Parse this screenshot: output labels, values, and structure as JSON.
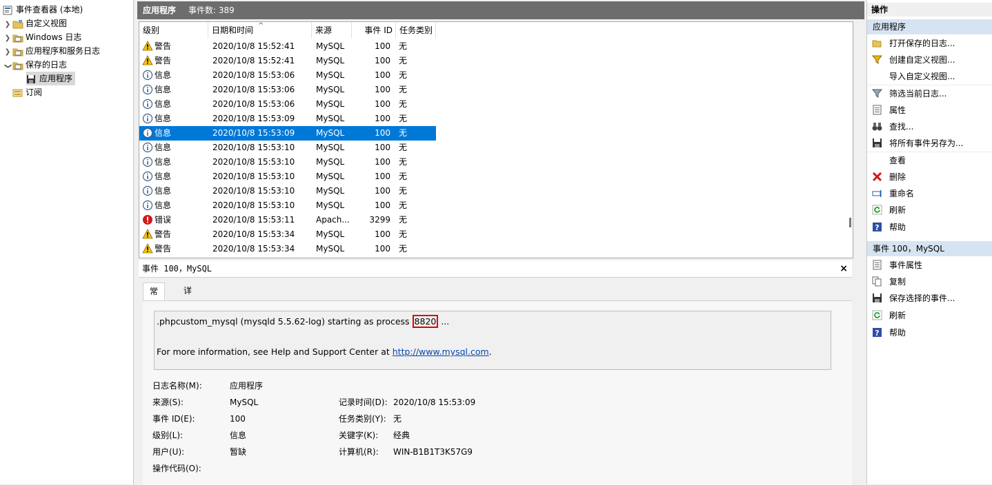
{
  "tree": {
    "root": "事件查看器 (本地)",
    "items": [
      {
        "label": "自定义视图",
        "chev": ">"
      },
      {
        "label": "Windows 日志",
        "chev": ">"
      },
      {
        "label": "应用程序和服务日志",
        "chev": ">"
      },
      {
        "label": "保存的日志",
        "chev": "v"
      },
      {
        "label": "应用程序",
        "chev": ""
      },
      {
        "label": "订阅",
        "chev": ""
      }
    ]
  },
  "header": {
    "title": "应用程序",
    "count": "事件数: 389"
  },
  "columns": [
    "级别",
    "日期和时间",
    "来源",
    "事件 ID",
    "任务类别"
  ],
  "rows": [
    {
      "level": "警告",
      "type": "warn",
      "dt": "2020/10/8 15:52:41",
      "src": "MySQL",
      "id": "100",
      "cat": "无"
    },
    {
      "level": "警告",
      "type": "warn",
      "dt": "2020/10/8 15:52:41",
      "src": "MySQL",
      "id": "100",
      "cat": "无"
    },
    {
      "level": "信息",
      "type": "info",
      "dt": "2020/10/8 15:53:06",
      "src": "MySQL",
      "id": "100",
      "cat": "无"
    },
    {
      "level": "信息",
      "type": "info",
      "dt": "2020/10/8 15:53:06",
      "src": "MySQL",
      "id": "100",
      "cat": "无"
    },
    {
      "level": "信息",
      "type": "info",
      "dt": "2020/10/8 15:53:06",
      "src": "MySQL",
      "id": "100",
      "cat": "无"
    },
    {
      "level": "信息",
      "type": "info",
      "dt": "2020/10/8 15:53:09",
      "src": "MySQL",
      "id": "100",
      "cat": "无"
    },
    {
      "level": "信息",
      "type": "info",
      "dt": "2020/10/8 15:53:09",
      "src": "MySQL",
      "id": "100",
      "cat": "无"
    },
    {
      "level": "信息",
      "type": "info",
      "dt": "2020/10/8 15:53:10",
      "src": "MySQL",
      "id": "100",
      "cat": "无"
    },
    {
      "level": "信息",
      "type": "info",
      "dt": "2020/10/8 15:53:10",
      "src": "MySQL",
      "id": "100",
      "cat": "无"
    },
    {
      "level": "信息",
      "type": "info",
      "dt": "2020/10/8 15:53:10",
      "src": "MySQL",
      "id": "100",
      "cat": "无"
    },
    {
      "level": "信息",
      "type": "info",
      "dt": "2020/10/8 15:53:10",
      "src": "MySQL",
      "id": "100",
      "cat": "无"
    },
    {
      "level": "信息",
      "type": "info",
      "dt": "2020/10/8 15:53:10",
      "src": "MySQL",
      "id": "100",
      "cat": "无"
    },
    {
      "level": "错误",
      "type": "error",
      "dt": "2020/10/8 15:53:11",
      "src": "Apach...",
      "id": "3299",
      "cat": "无"
    },
    {
      "level": "警告",
      "type": "warn",
      "dt": "2020/10/8 15:53:34",
      "src": "MySQL",
      "id": "100",
      "cat": "无"
    },
    {
      "level": "警告",
      "type": "warn",
      "dt": "2020/10/8 15:53:34",
      "src": "MySQL",
      "id": "100",
      "cat": "无"
    }
  ],
  "selected_row": 6,
  "detail": {
    "title": "事件 100，MySQL",
    "close": "×",
    "tabs": [
      "常规",
      "详细信息"
    ],
    "msg_prefix": ".phpcustom_mysql (mysqld 5.5.62-log) starting as process ",
    "msg_pid": "8820",
    "msg_suffix": " ...",
    "msg2_prefix": "For more information, see Help and Support Center at ",
    "msg2_link": "http://www.mysql.com",
    "msg2_suffix": ".",
    "props": {
      "log_name_label": "日志名称(M):",
      "log_name": "应用程序",
      "source_label": "来源(S):",
      "source": "MySQL",
      "recorded_label": "记录时间(D):",
      "recorded": "2020/10/8 15:53:09",
      "event_id_label": "事件 ID(E):",
      "event_id": "100",
      "task_label": "任务类别(Y):",
      "task": "无",
      "level_label": "级别(L):",
      "level": "信息",
      "keywords_label": "关键字(K):",
      "keywords": "经典",
      "user_label": "用户(U):",
      "user": "暂缺",
      "computer_label": "计算机(R):",
      "computer": "WIN-B1B1T3K57G9",
      "opcode_label": "操作代码(O):"
    }
  },
  "actions": {
    "title": "操作",
    "section1": "应用程序",
    "items1": [
      "打开保存的日志...",
      "创建自定义视图...",
      "导入自定义视图...",
      "筛选当前日志...",
      "属性",
      "查找...",
      "将所有事件另存为...",
      "查看",
      "删除",
      "重命名",
      "刷新",
      "帮助"
    ],
    "section2": "事件 100，MySQL",
    "items2": [
      "事件属性",
      "复制",
      "保存选择的事件...",
      "刷新",
      "帮助"
    ]
  },
  "colors": {
    "selection": "#0078d7",
    "header_bg": "#6d6d6d",
    "section_bg": "#d6e3f2"
  }
}
